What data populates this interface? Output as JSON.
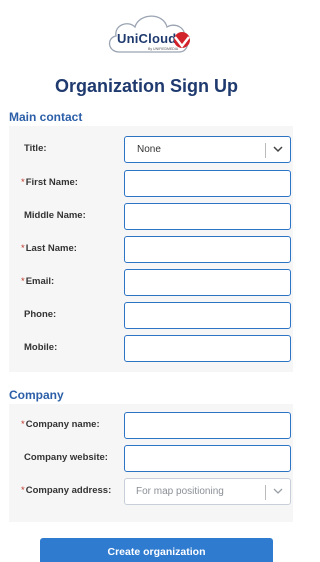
{
  "logo": {
    "brand": "UniCloud",
    "sub": "By UNIFIEDMEDIA"
  },
  "page_title": "Organization Sign Up",
  "main_contact": {
    "title": "Main contact",
    "fields": {
      "title_label": "Title:",
      "title_value": "None",
      "first_name_label": "First Name:",
      "middle_name_label": "Middle Name:",
      "last_name_label": "Last Name:",
      "email_label": "Email:",
      "phone_label": "Phone:",
      "mobile_label": "Mobile:",
      "required_mark": "*"
    }
  },
  "company": {
    "title": "Company",
    "fields": {
      "name_label": "Company name:",
      "website_label": "Company website:",
      "address_label": "Company address:",
      "address_placeholder": "For map positioning",
      "required_mark": "*"
    }
  },
  "submit_label": "Create organization",
  "colors": {
    "brand_navy": "#1f3a6e",
    "accent_blue": "#2e74c6",
    "required_red": "#c0392b",
    "logo_red": "#d3232a"
  }
}
